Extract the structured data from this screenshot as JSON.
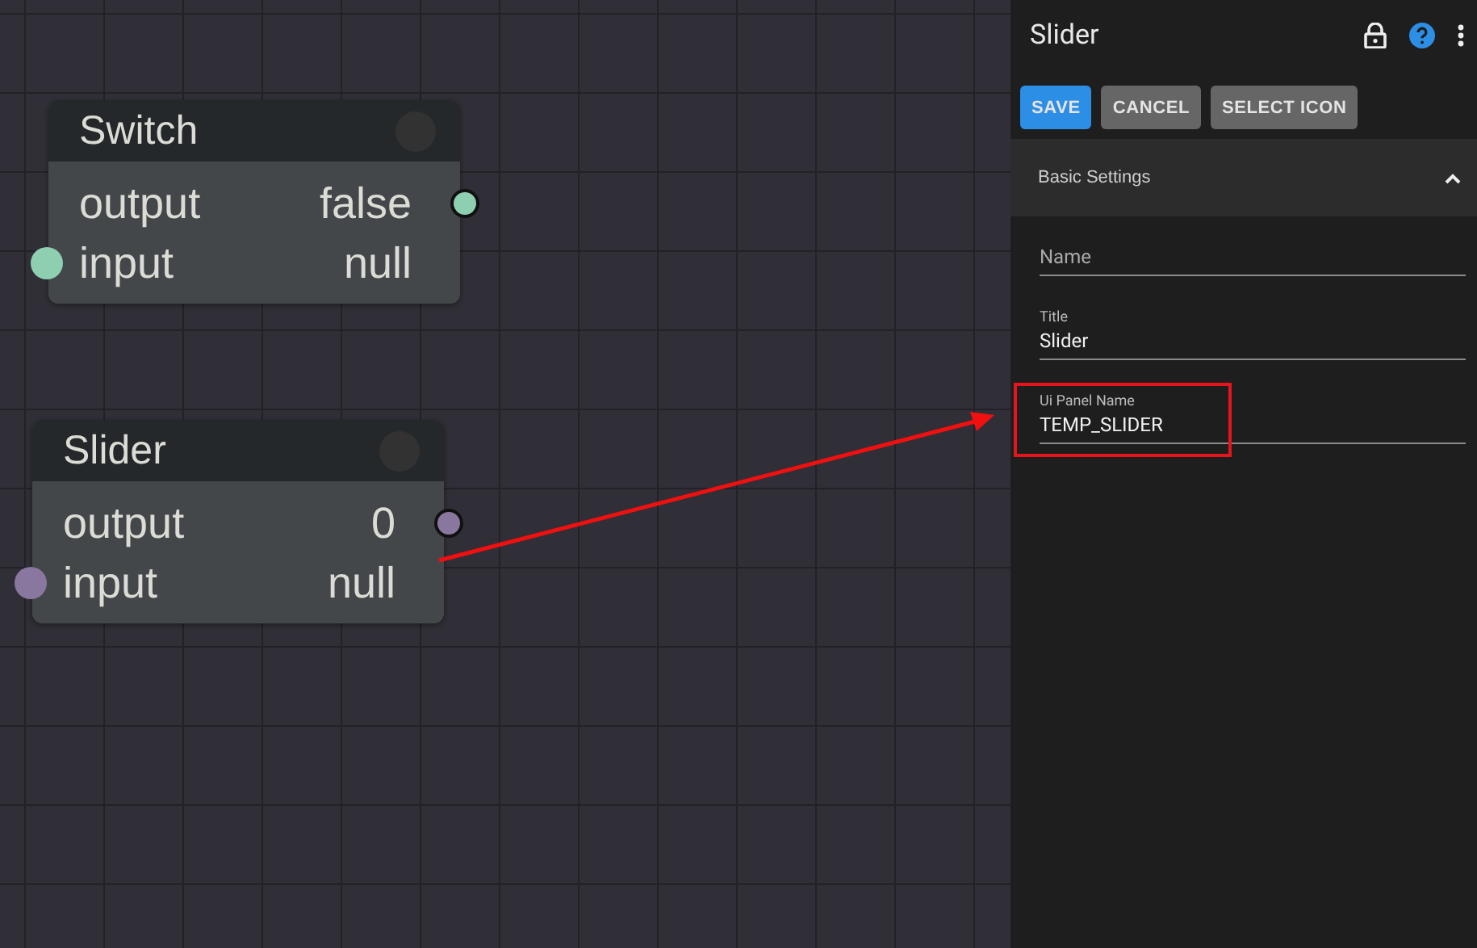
{
  "canvas": {
    "nodes": [
      {
        "title": "Switch",
        "color": "#8fcfb1",
        "rows": [
          {
            "name": "output",
            "value": "false",
            "kind": "output"
          },
          {
            "name": "input",
            "value": "null",
            "kind": "input"
          }
        ]
      },
      {
        "title": "Slider",
        "color": "#8a77a0",
        "rows": [
          {
            "name": "output",
            "value": "0",
            "kind": "output"
          },
          {
            "name": "input",
            "value": "null",
            "kind": "input"
          }
        ]
      }
    ]
  },
  "panel": {
    "title": "Slider",
    "buttons": [
      {
        "label": "SAVE",
        "kind": "primary"
      },
      {
        "label": "CANCEL",
        "kind": "secondary"
      },
      {
        "label": "SELECT ICON",
        "kind": "secondary"
      }
    ],
    "section": {
      "title": "Basic Settings",
      "expanded": true
    },
    "fields": [
      {
        "placeholder": "Name",
        "highlighted": false
      },
      {
        "label": "Title",
        "value": "Slider",
        "highlighted": false
      },
      {
        "label": "Ui Panel Name",
        "value": "TEMP_SLIDER",
        "highlighted": true
      }
    ]
  }
}
